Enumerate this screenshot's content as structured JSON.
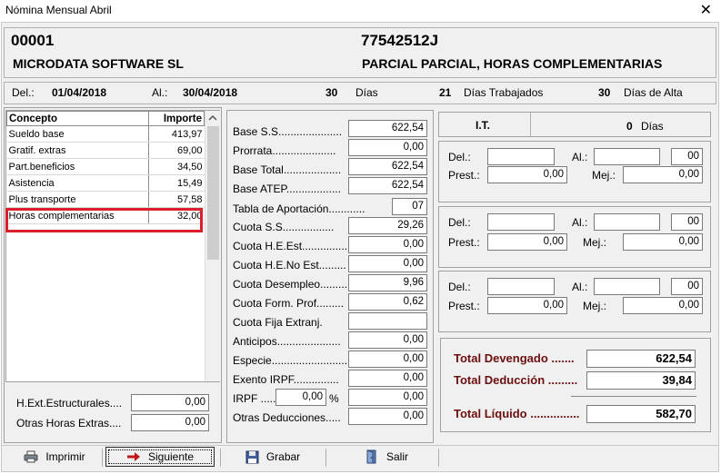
{
  "window": {
    "title": "Nómina Mensual Abril",
    "close": "✕"
  },
  "header": {
    "code": "00001",
    "nif": "77542512J",
    "company": "MICRODATA SOFTWARE SL",
    "contract": "PARCIAL PARCIAL, HORAS COMPLEMENTARIAS"
  },
  "dates": {
    "del_label": "Del.:",
    "del_value": "01/04/2018",
    "al_label": "Al.:",
    "al_value": "30/04/2018",
    "dias": "30",
    "dias_label": "Días",
    "trabajados": "21",
    "trabajados_label": "Días Trabajados",
    "alta": "30",
    "alta_label": "Días de Alta"
  },
  "concepts": {
    "col_concepto": "Concepto",
    "col_importe": "Importe",
    "rows": [
      {
        "concepto": "Sueldo base",
        "importe": "413,97"
      },
      {
        "concepto": "Gratif. extras",
        "importe": "69,00"
      },
      {
        "concepto": "Part.beneficios",
        "importe": "34,50"
      },
      {
        "concepto": "Asistencia",
        "importe": "15,49"
      },
      {
        "concepto": "Plus transporte",
        "importe": "57,58"
      },
      {
        "concepto": "Horas complementarias",
        "importe": "32,00"
      }
    ]
  },
  "extras": {
    "hext_label": "H.Ext.Estructurales....",
    "hext_value": "0,00",
    "otras_label": "Otras Horas Extras....",
    "otras_value": "0,00"
  },
  "calc": {
    "base_ss": {
      "label": "Base S.S.....................",
      "value": "622,54"
    },
    "prorrata": {
      "label": "Prorrata.....................",
      "value": "0,00"
    },
    "base_total": {
      "label": "Base Total...................",
      "value": "622,54"
    },
    "base_atep": {
      "label": "Base ATEP..................",
      "value": "622,54"
    },
    "tabla": {
      "label": "Tabla de Aportación............",
      "value": "07"
    },
    "cuota_ss": {
      "label": "Cuota S.S.................",
      "value": "29,26"
    },
    "cuota_he_est": {
      "label": "Cuota H.E.Est...............",
      "value": "0,00"
    },
    "cuota_he_noest": {
      "label": "Cuota H.E.No Est.........",
      "value": "0,00"
    },
    "cuota_desempleo": {
      "label": "Cuota Desempleo.........",
      "value": "9,96"
    },
    "cuota_form": {
      "label": "Cuota Form. Prof.........",
      "value": "0,62"
    },
    "cuota_fija": {
      "label": "Cuota Fija Extranj.",
      "value": ""
    },
    "anticipos": {
      "label": "Anticipos.....................",
      "value": "0,00"
    },
    "especie": {
      "label": "Especie.........................",
      "value": "0,00"
    },
    "exento": {
      "label": "Exento IRPF...............",
      "value": "0,00"
    },
    "irpf": {
      "label": "IRPF .....",
      "pct": "0,00",
      "pct_sign": "%",
      "value": "0,00"
    },
    "otras_ded": {
      "label": "Otras Deducciones.....",
      "value": "0,00"
    }
  },
  "it": {
    "label": "I.T.",
    "dias": "0",
    "dias_label": "Días",
    "blocks": [
      {
        "del": "",
        "al": "",
        "num": "00",
        "prest": "0,00",
        "mej": "0,00"
      },
      {
        "del": "",
        "al": "",
        "num": "00",
        "prest": "0,00",
        "mej": "0,00"
      },
      {
        "del": "",
        "al": "",
        "num": "00",
        "prest": "0,00",
        "mej": "0,00"
      }
    ],
    "del_label": "Del.:",
    "al_label": "Al.:",
    "prest_label": "Prest.:",
    "mej_label": "Mej.:"
  },
  "totals": {
    "devengado_label": "Total Devengado .......",
    "devengado": "622,54",
    "deduccion_label": "Total Deducción .........",
    "deduccion": "39,84",
    "liquido_label": "Total Líquido ...............",
    "liquido": "582,70"
  },
  "toolbar": {
    "imprimir": "Imprimir",
    "siguiente": "Siguiente",
    "grabar": "Grabar",
    "salir": "Salir"
  }
}
